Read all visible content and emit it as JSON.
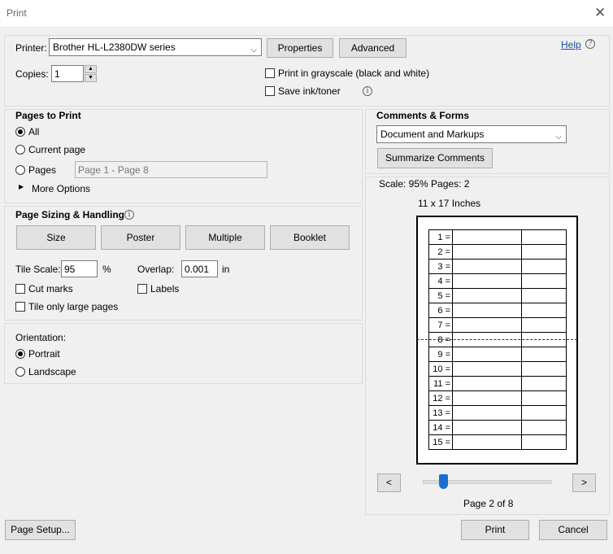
{
  "window": {
    "title": "Print",
    "close_glyph": "✕"
  },
  "printer": {
    "label": "Printer:",
    "selected": "Brother HL-L2380DW series",
    "properties_label": "Properties",
    "advanced_label": "Advanced",
    "help_label": "Help",
    "copies_label": "Copies:",
    "copies_value": "1",
    "grayscale_label": "Print in grayscale (black and white)",
    "grayscale_checked": false,
    "save_ink_label": "Save ink/toner",
    "save_ink_checked": false
  },
  "pages_to_print": {
    "header": "Pages to Print",
    "all_label": "All",
    "current_label": "Current page",
    "pages_label": "Pages",
    "pages_value": "Page 1 - Page 8",
    "selected": "all",
    "more_options_label": "More Options"
  },
  "sizing": {
    "header": "Page Sizing & Handling",
    "buttons": [
      "Size",
      "Poster",
      "Multiple",
      "Booklet"
    ],
    "active": "Poster",
    "tile_scale_label": "Tile Scale:",
    "tile_scale_value": "95",
    "percent": "%",
    "overlap_label": "Overlap:",
    "overlap_value": "0.001",
    "overlap_unit": "in",
    "cut_marks_label": "Cut marks",
    "labels_label": "Labels",
    "tile_large_label": "Tile only large pages"
  },
  "orientation": {
    "header": "Orientation:",
    "portrait_label": "Portrait",
    "landscape_label": "Landscape",
    "selected": "portrait"
  },
  "comments": {
    "header": "Comments & Forms",
    "selected": "Document and Markups",
    "summarize_label": "Summarize Comments"
  },
  "preview": {
    "scale_text": "Scale:  95% Pages: 2",
    "paper_size": "11 x 17 Inches",
    "rows": [
      "1 =",
      "2 =",
      "3 =",
      "4 =",
      "5 =",
      "6 =",
      "7 =",
      "8 =",
      "9 =",
      "10 =",
      "11 =",
      "12 =",
      "13 =",
      "14 =",
      "15 ="
    ],
    "prev_label": "<",
    "next_label": ">",
    "page_indicator": "Page 2 of 8",
    "slider_position": "2 of 8"
  },
  "footer": {
    "page_setup_label": "Page Setup...",
    "print_label": "Print",
    "cancel_label": "Cancel"
  }
}
